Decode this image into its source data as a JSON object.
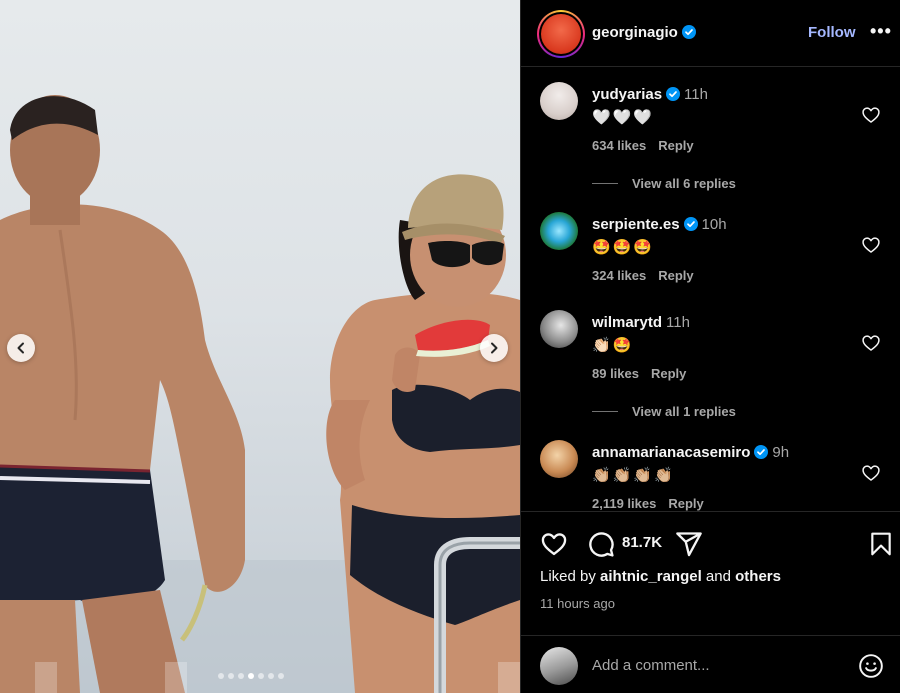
{
  "post": {
    "author": "georginagio",
    "follow_label": "Follow",
    "more_label": "•••",
    "carousel": {
      "slide_count": 7,
      "active_index": 3
    }
  },
  "comments": [
    {
      "user": "yudyarias",
      "verified": true,
      "time": "11h",
      "text": "🤍🤍🤍",
      "likes": "634 likes",
      "reply_label": "Reply",
      "view_replies": "View all 6 replies"
    },
    {
      "user": "serpiente.es",
      "verified": true,
      "time": "10h",
      "text": "🤩🤩🤩",
      "likes": "324 likes",
      "reply_label": "Reply"
    },
    {
      "user": "wilmarytd",
      "verified": false,
      "time": "11h",
      "text": "👏🏻🤩",
      "likes": "89 likes",
      "reply_label": "Reply",
      "view_replies": "View all 1 replies"
    },
    {
      "user": "annamarianacasemiro",
      "verified": true,
      "time": "9h",
      "text": "👏🏼👏🏼👏🏼👏🏼",
      "likes": "2,119 likes",
      "reply_label": "Reply"
    }
  ],
  "actions": {
    "comment_count": "81.7K",
    "liked_by_prefix": "Liked by",
    "liked_by_user": "aihtnic_rangel",
    "liked_by_and": "and",
    "liked_by_others": "others",
    "time_ago": "11 hours ago"
  },
  "add_comment": {
    "placeholder": "Add a comment..."
  },
  "colors": {
    "accent": "#a5b8ff",
    "verified": "#0095f6",
    "background": "#000000",
    "muted": "#a8a8a8"
  }
}
